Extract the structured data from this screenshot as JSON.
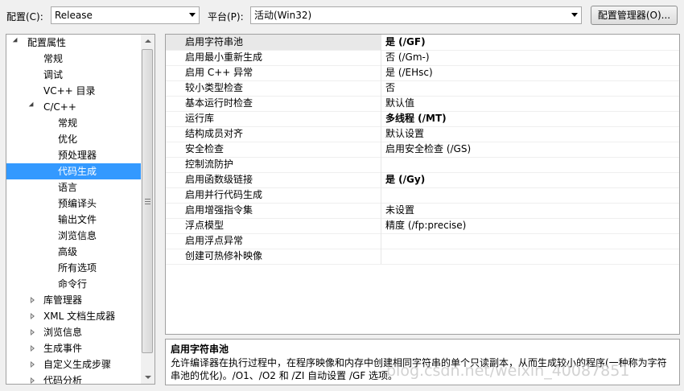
{
  "toolbar": {
    "config_label": "配置(C):",
    "config_value": "Release",
    "platform_label": "平台(P):",
    "platform_value": "活动(Win32)",
    "manager_button": "配置管理器(O)..."
  },
  "tree": {
    "items": [
      {
        "label": "配置属性",
        "level": 0,
        "state": "open",
        "selected": false
      },
      {
        "label": "常规",
        "level": 1,
        "state": "none",
        "selected": false
      },
      {
        "label": "调试",
        "level": 1,
        "state": "none",
        "selected": false
      },
      {
        "label": "VC++ 目录",
        "level": 1,
        "state": "none",
        "selected": false
      },
      {
        "label": "C/C++",
        "level": 1,
        "state": "open",
        "selected": false
      },
      {
        "label": "常规",
        "level": 2,
        "state": "none",
        "selected": false
      },
      {
        "label": "优化",
        "level": 2,
        "state": "none",
        "selected": false
      },
      {
        "label": "预处理器",
        "level": 2,
        "state": "none",
        "selected": false
      },
      {
        "label": "代码生成",
        "level": 2,
        "state": "none",
        "selected": true
      },
      {
        "label": "语言",
        "level": 2,
        "state": "none",
        "selected": false
      },
      {
        "label": "预编译头",
        "level": 2,
        "state": "none",
        "selected": false
      },
      {
        "label": "输出文件",
        "level": 2,
        "state": "none",
        "selected": false
      },
      {
        "label": "浏览信息",
        "level": 2,
        "state": "none",
        "selected": false
      },
      {
        "label": "高级",
        "level": 2,
        "state": "none",
        "selected": false
      },
      {
        "label": "所有选项",
        "level": 2,
        "state": "none",
        "selected": false
      },
      {
        "label": "命令行",
        "level": 2,
        "state": "none",
        "selected": false
      },
      {
        "label": "库管理器",
        "level": 1,
        "state": "closed",
        "selected": false
      },
      {
        "label": "XML 文档生成器",
        "level": 1,
        "state": "closed",
        "selected": false
      },
      {
        "label": "浏览信息",
        "level": 1,
        "state": "closed",
        "selected": false
      },
      {
        "label": "生成事件",
        "level": 1,
        "state": "closed",
        "selected": false
      },
      {
        "label": "自定义生成步骤",
        "level": 1,
        "state": "closed",
        "selected": false
      },
      {
        "label": "代码分析",
        "level": 1,
        "state": "closed",
        "selected": false
      }
    ]
  },
  "properties": [
    {
      "name": "启用字符串池",
      "value": "是 (/GF)",
      "bold": true
    },
    {
      "name": "启用最小重新生成",
      "value": "否 (/Gm-)",
      "bold": false
    },
    {
      "name": "启用 C++ 异常",
      "value": "是 (/EHsc)",
      "bold": false
    },
    {
      "name": "较小类型检查",
      "value": "否",
      "bold": false
    },
    {
      "name": "基本运行时检查",
      "value": "默认值",
      "bold": false
    },
    {
      "name": "运行库",
      "value": "多线程 (/MT)",
      "bold": true
    },
    {
      "name": "结构成员对齐",
      "value": "默认设置",
      "bold": false
    },
    {
      "name": "安全检查",
      "value": "启用安全检查 (/GS)",
      "bold": false
    },
    {
      "name": "控制流防护",
      "value": "",
      "bold": false
    },
    {
      "name": "启用函数级链接",
      "value": "是 (/Gy)",
      "bold": true
    },
    {
      "name": "启用并行代码生成",
      "value": "",
      "bold": false
    },
    {
      "name": "启用增强指令集",
      "value": "未设置",
      "bold": false
    },
    {
      "name": "浮点模型",
      "value": "精度 (/fp:precise)",
      "bold": false
    },
    {
      "name": "启用浮点异常",
      "value": "",
      "bold": false
    },
    {
      "name": "创建可热修补映像",
      "value": "",
      "bold": false
    }
  ],
  "description": {
    "title": "启用字符串池",
    "text": "允许编译器在执行过程中，在程序映像和内存中创建相同字符串的单个只读副本，从而生成较小的程序(一种称为字符串池的优化)。/O1、/O2 和 /ZI 自动设置 /GF 选项。"
  },
  "watermark": "blog.csdn.net/weixin_40087851"
}
